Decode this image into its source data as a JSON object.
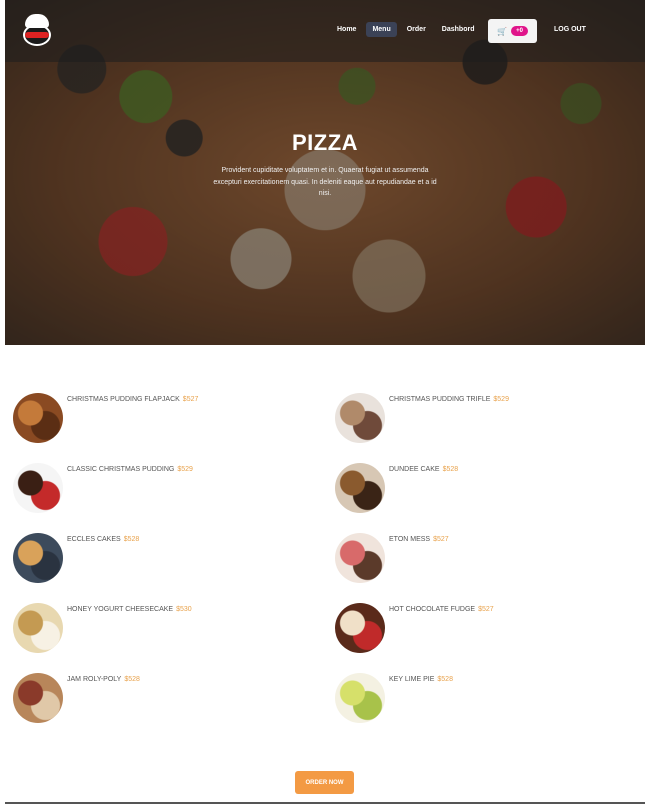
{
  "nav": {
    "links": [
      {
        "label": "Home",
        "active": false
      },
      {
        "label": "Menu",
        "active": true
      },
      {
        "label": "Order",
        "active": false
      },
      {
        "label": "Dashbord",
        "active": false
      }
    ],
    "cart_count": "+0",
    "cart_icon": "cart-icon",
    "logout_label": "LOG OUT"
  },
  "hero": {
    "title": "PIZZA",
    "description": "Provident cupiditate voluptatem et in. Quaerat fugiat ut assumenda excepturi exercitationem quasi. In deleniti eaque aut repudiandae et a id nisi."
  },
  "menu": {
    "items": [
      {
        "name": "CHRISTMAS PUDDING FLAPJACK",
        "price": "$527",
        "colors": [
          "#8a4a22",
          "#c47a3a",
          "#5b2e14"
        ]
      },
      {
        "name": "CHRISTMAS PUDDING TRIFLE",
        "price": "$529",
        "colors": [
          "#e9e2dc",
          "#b08a6a",
          "#6f4a3a"
        ]
      },
      {
        "name": "CLASSIC CHRISTMAS PUDDING",
        "price": "$529",
        "colors": [
          "#f5f5f5",
          "#3a1f14",
          "#c42a2a"
        ]
      },
      {
        "name": "DUNDEE CAKE",
        "price": "$528",
        "colors": [
          "#d7c7b4",
          "#8a5a2e",
          "#3a2416"
        ]
      },
      {
        "name": "ECCLES CAKES",
        "price": "$528",
        "colors": [
          "#3d4b5c",
          "#d9a25a",
          "#2a3340"
        ]
      },
      {
        "name": "ETON MESS",
        "price": "$527",
        "colors": [
          "#f0e4dc",
          "#d86a6a",
          "#5b3a2a"
        ]
      },
      {
        "name": "HONEY YOGURT CHEESECAKE",
        "price": "$530",
        "colors": [
          "#e8d8b0",
          "#c49a52",
          "#f7f1e4"
        ]
      },
      {
        "name": "HOT CHOCOLATE FUDGE",
        "price": "$527",
        "colors": [
          "#5a2a1a",
          "#f0e0c8",
          "#c02a2a"
        ]
      },
      {
        "name": "JAM ROLY-POLY",
        "price": "$528",
        "colors": [
          "#b8865a",
          "#8a3a2a",
          "#e0c8a8"
        ]
      },
      {
        "name": "KEY LIME PIE",
        "price": "$528",
        "colors": [
          "#f4f1e2",
          "#d6e06a",
          "#a8c24a"
        ]
      }
    ]
  },
  "order": {
    "label": "ORDER NOW"
  },
  "colors": {
    "accent": "#f39a44",
    "price": "#e8a14a",
    "badge": "#e0148a",
    "nav_active": "#3b4256"
  }
}
